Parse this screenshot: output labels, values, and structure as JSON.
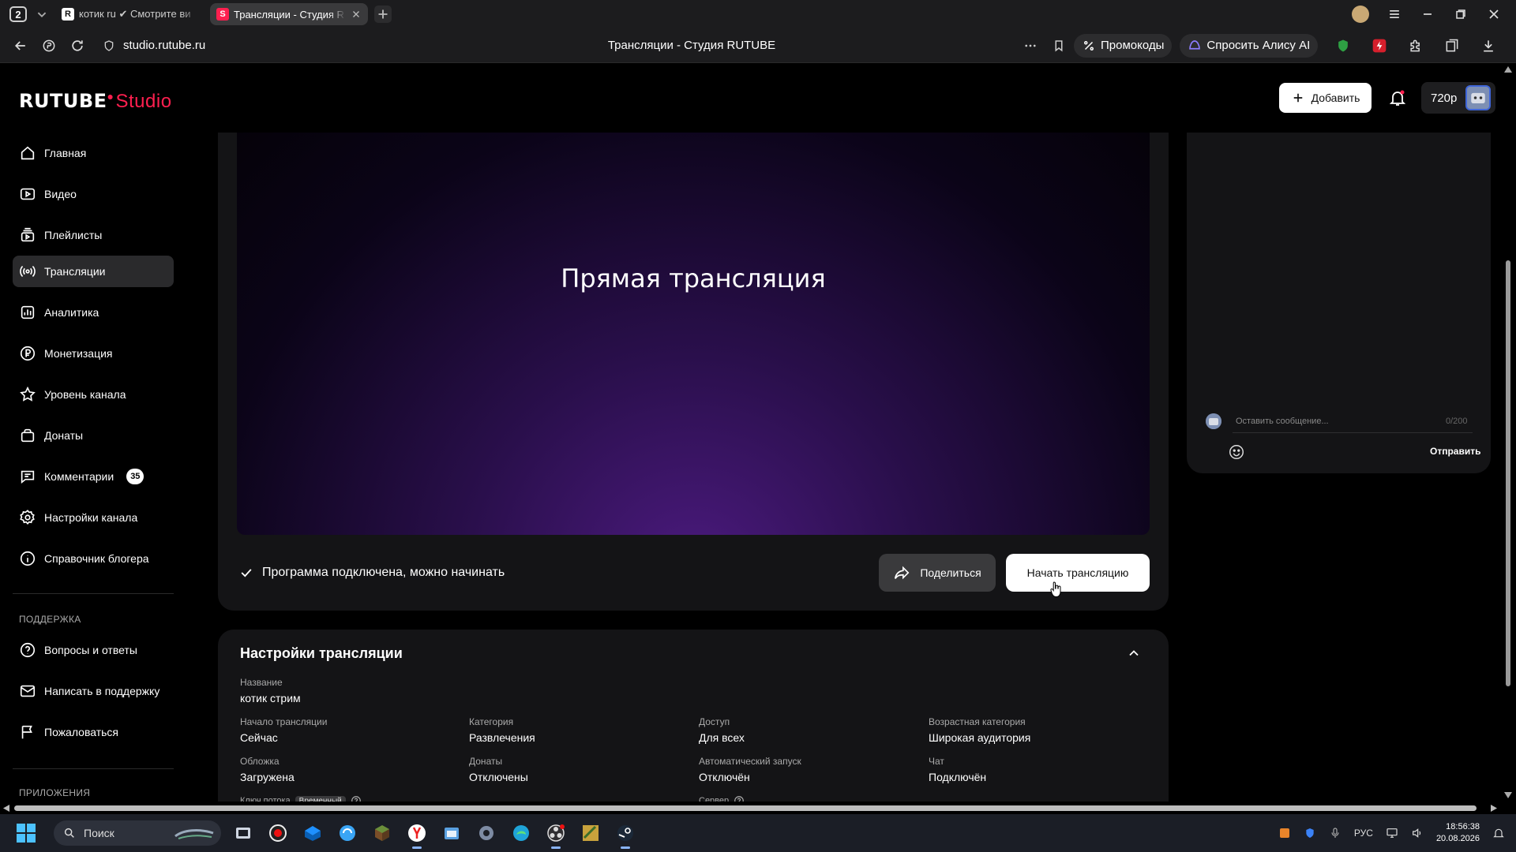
{
  "browser": {
    "tab_count": "2",
    "tabs": [
      {
        "title": "котик ru ✔ Смотрите ви",
        "favicon": "R",
        "favicon_color": "#111111"
      },
      {
        "title": "Трансляции - Студия R",
        "favicon": "S",
        "favicon_color": "#ff1f4f",
        "active": true
      }
    ],
    "url": "studio.rutube.ru",
    "page_title": "Трансляции - Студия RUTUBE",
    "promo_label": "Промокоды",
    "alice_label": "Спросить Алису AI"
  },
  "app": {
    "logo_main": "RUTUBE",
    "logo_studio": "Studio",
    "add_label": "Добавить",
    "quality": "720p",
    "accent": "#ff1f4f"
  },
  "sidebar": {
    "items": [
      {
        "label": "Главная",
        "icon": "home-icon"
      },
      {
        "label": "Видео",
        "icon": "video-icon"
      },
      {
        "label": "Плейлисты",
        "icon": "playlist-icon"
      },
      {
        "label": "Трансляции",
        "icon": "broadcast-icon",
        "active": true
      },
      {
        "label": "Аналитика",
        "icon": "analytics-icon"
      },
      {
        "label": "Монетизация",
        "icon": "ruble-icon"
      },
      {
        "label": "Уровень канала",
        "icon": "star-icon"
      },
      {
        "label": "Донаты",
        "icon": "gift-icon"
      },
      {
        "label": "Комментарии",
        "icon": "comment-icon",
        "badge": "35"
      },
      {
        "label": "Настройки канала",
        "icon": "gear-icon"
      },
      {
        "label": "Справочник блогера",
        "icon": "info-icon"
      }
    ],
    "support_header": "ПОДДЕРЖКА",
    "support_items": [
      {
        "label": "Вопросы и ответы",
        "icon": "question-icon"
      },
      {
        "label": "Написать в поддержку",
        "icon": "mail-icon"
      },
      {
        "label": "Пожаловаться",
        "icon": "flag-icon"
      }
    ],
    "apps_header": "ПРИЛОЖЕНИЯ"
  },
  "player": {
    "title": "Прямая трансляция",
    "status": "Программа подключена, можно начинать",
    "share_label": "Поделиться",
    "start_label": "Начать трансляцию"
  },
  "settings": {
    "title": "Настройки трансляции",
    "name_label": "Название",
    "name_value": "котик стрим",
    "fields": [
      {
        "label": "Начало трансляции",
        "value": "Сейчас"
      },
      {
        "label": "Категория",
        "value": "Развлечения"
      },
      {
        "label": "Доступ",
        "value": "Для всех"
      },
      {
        "label": "Возрастная категория",
        "value": "Широкая аудитория"
      },
      {
        "label": "Обложка",
        "value": "Загружена"
      },
      {
        "label": "Донаты",
        "value": "Отключены"
      },
      {
        "label": "Автоматический запуск",
        "value": "Отключён"
      },
      {
        "label": "Чат",
        "value": "Подключён"
      }
    ],
    "stream_key_label": "Ключ потока",
    "stream_key_tag": "Временный",
    "server_label": "Сервер"
  },
  "chat": {
    "placeholder": "Оставить сообщение...",
    "counter": "0/200",
    "send_label": "Отправить"
  },
  "taskbar": {
    "search_label": "Поиск",
    "lang": "РУС",
    "time": "18:56:38",
    "date": "20.08.2026"
  }
}
